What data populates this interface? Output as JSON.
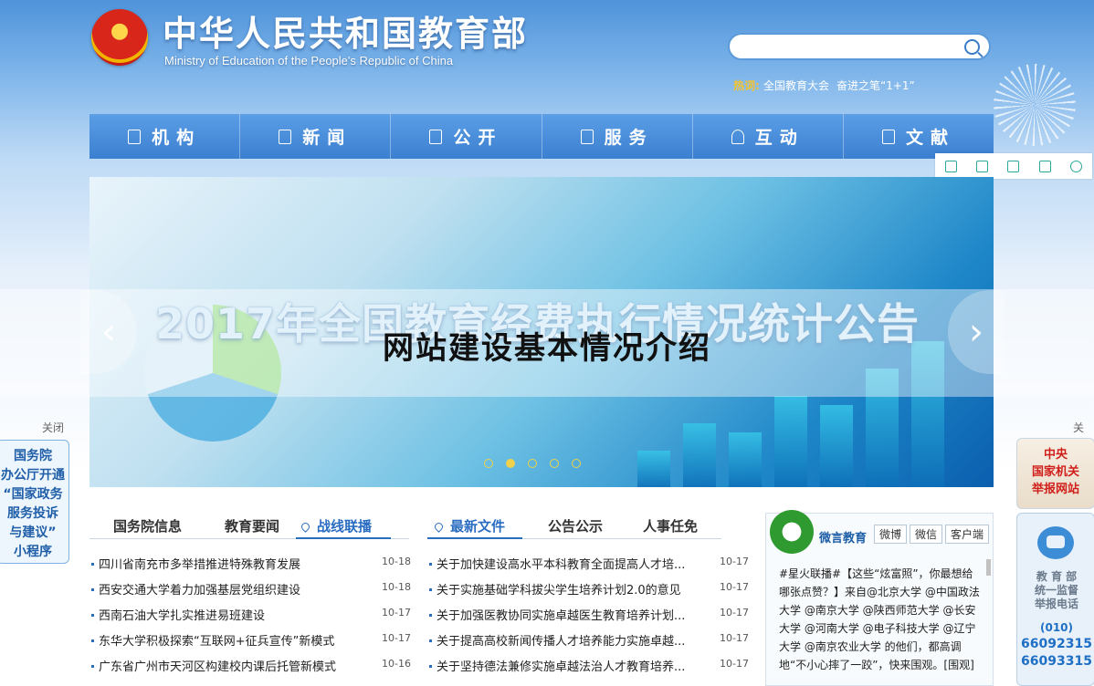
{
  "header": {
    "title": "中华人民共和国教育部",
    "subtitle": "Ministry of Education of the People's Republic of China",
    "search": {
      "placeholder": "",
      "value": ""
    },
    "hot_label": "热词:",
    "hot_items": [
      "全国教育大会",
      "奋进之笔“1+1”"
    ]
  },
  "nav": {
    "items": [
      {
        "label": "机构",
        "icon": "org-icon"
      },
      {
        "label": "新闻",
        "icon": "news-icon"
      },
      {
        "label": "公开",
        "icon": "lock-icon"
      },
      {
        "label": "服务",
        "icon": "service-icon"
      },
      {
        "label": "互动",
        "icon": "heart-icon"
      },
      {
        "label": "文献",
        "icon": "document-icon"
      }
    ]
  },
  "toolbar": [
    "mobile-icon",
    "fullscreen-icon",
    "save-icon",
    "share-icon",
    "settings-icon"
  ],
  "banner": {
    "headline": "2017年全国教育经费执行情况统计公告",
    "overlay_title": "网站建设基本情况介绍",
    "prev": "‹",
    "next": "›",
    "slide_count": 5,
    "active_slide": 2
  },
  "side_left": {
    "close": "关闭",
    "lines": [
      "国务院",
      "办公厅开通",
      "“国家政务",
      "服务投诉",
      "与建议”",
      "小程序"
    ]
  },
  "side_right": {
    "close": "关闭",
    "report_lines": [
      "中央",
      "国家机关",
      "举报网站"
    ],
    "hotline_lines": [
      "教 育 部",
      "统一监督",
      "举报电话"
    ],
    "area_code": "(010)",
    "phones": [
      "66092315",
      "66093315"
    ]
  },
  "left_tabs": [
    "国务院信息",
    "教育要闻",
    "战线联播"
  ],
  "right_tabs": [
    "最新文件",
    "公告公示",
    "人事任免"
  ],
  "left_news": [
    {
      "title": "四川省南充市多举措推进特殊教育发展",
      "date": "10-18"
    },
    {
      "title": "西安交通大学着力加强基层党组织建设",
      "date": "10-18"
    },
    {
      "title": "西南石油大学扎实推进易班建设",
      "date": "10-17"
    },
    {
      "title": "东华大学积极探索“互联网+征兵宣传”新模式",
      "date": "10-17"
    },
    {
      "title": "广东省广州市天河区构建校内课后托管新模式",
      "date": "10-16"
    }
  ],
  "right_news": [
    {
      "title": "关于加快建设高水平本科教育全面提高人才培...",
      "date": "10-17"
    },
    {
      "title": "关于实施基础学科拔尖学生培养计划2.0的意见",
      "date": "10-17"
    },
    {
      "title": "关于加强医教协同实施卓越医生教育培养计划...",
      "date": "10-17"
    },
    {
      "title": "关于提高高校新闻传播人才培养能力实施卓越...",
      "date": "10-17"
    },
    {
      "title": "关于坚持德法兼修实施卓越法治人才教育培养...",
      "date": "10-17"
    }
  ],
  "weibo": {
    "name": "微言教育",
    "tabs": [
      "微博",
      "微信",
      "客户端"
    ],
    "text": "#星火联播#【这些“炫富照”，你最想给哪张点赞？】来自@北京大学 @中国政法大学 @南京大学 @陕西师范大学 @长安大学 @河南大学 @电子科技大学 @辽宁大学 @南京农业大学 的他们，都高调地“不小心摔了一跤”，快来围观。[围观]"
  },
  "colors": {
    "nav_bg": "#3b7fd0",
    "accent": "#2a6cc2",
    "hot_label": "#f6c32a",
    "report_red": "#d0201b"
  }
}
